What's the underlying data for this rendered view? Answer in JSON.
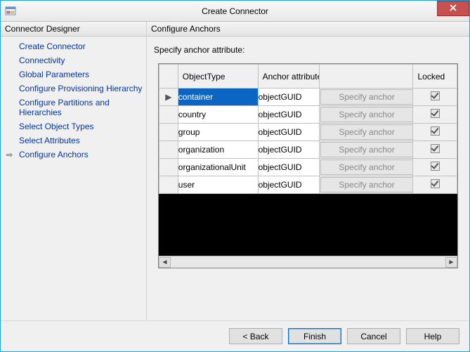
{
  "window": {
    "title": "Create Connector"
  },
  "sidebar": {
    "header": "Connector Designer",
    "items": [
      {
        "label": "Create Connector"
      },
      {
        "label": "Connectivity"
      },
      {
        "label": "Global Parameters"
      },
      {
        "label": "Configure Provisioning Hierarchy"
      },
      {
        "label": "Configure Partitions and Hierarchies"
      },
      {
        "label": "Select Object Types"
      },
      {
        "label": "Select Attributes"
      },
      {
        "label": "Configure Anchors"
      }
    ],
    "active_index": 7
  },
  "main": {
    "header": "Configure Anchors",
    "instruction": "Specify anchor attribute:",
    "columns": {
      "objectType": "ObjectType",
      "anchor": "Anchor attribute",
      "action": "",
      "locked": "Locked"
    },
    "action_button_label": "Specify anchor",
    "rows": [
      {
        "objectType": "container",
        "anchor": "objectGUID",
        "locked": true,
        "selected": true
      },
      {
        "objectType": "country",
        "anchor": "objectGUID",
        "locked": true,
        "selected": false
      },
      {
        "objectType": "group",
        "anchor": "objectGUID",
        "locked": true,
        "selected": false
      },
      {
        "objectType": "organization",
        "anchor": "objectGUID",
        "locked": true,
        "selected": false
      },
      {
        "objectType": "organizationalUnit",
        "anchor": "objectGUID",
        "locked": true,
        "selected": false
      },
      {
        "objectType": "user",
        "anchor": "objectGUID",
        "locked": true,
        "selected": false
      }
    ]
  },
  "buttons": {
    "back": "<  Back",
    "finish": "Finish",
    "cancel": "Cancel",
    "help": "Help"
  }
}
